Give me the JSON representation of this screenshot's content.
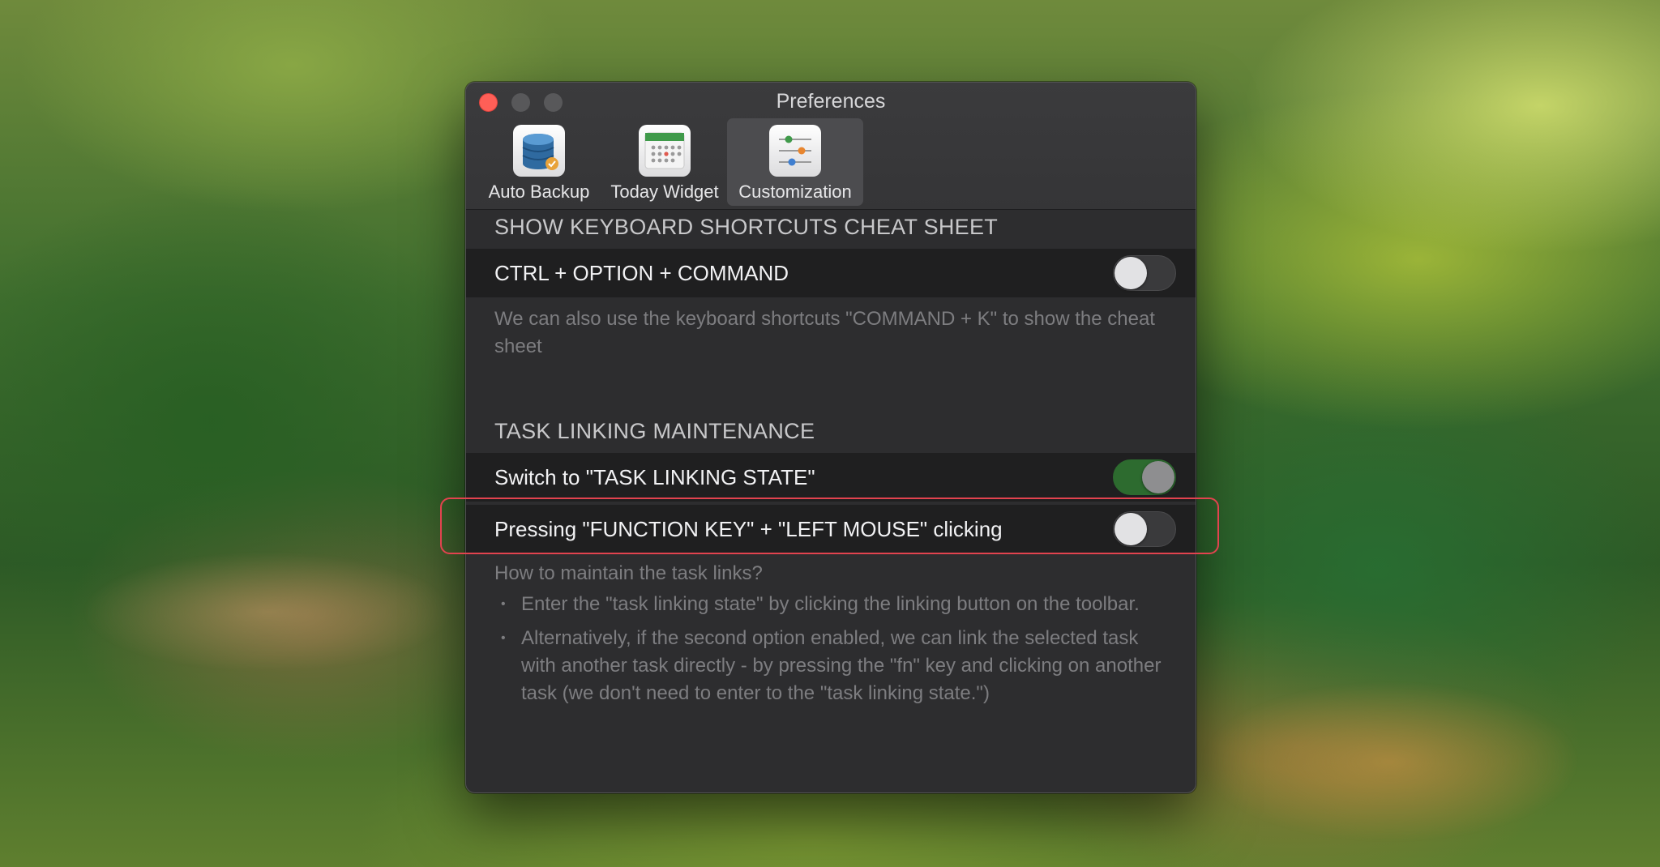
{
  "window": {
    "title": "Preferences"
  },
  "toolbar": {
    "tabs": [
      {
        "label": "Auto Backup",
        "icon": "database-icon",
        "active": false
      },
      {
        "label": "Today Widget",
        "icon": "calendar-icon",
        "active": false
      },
      {
        "label": "Customization",
        "icon": "sliders-icon",
        "active": true
      }
    ]
  },
  "cheat_sheet": {
    "title": "SHOW KEYBOARD SHORTCUTS CHEAT SHEET",
    "row_label": "CTRL + OPTION + COMMAND",
    "enabled": false,
    "description": "We can also use the keyboard shortcuts \"COMMAND + K\" to show the cheat sheet"
  },
  "task_linking": {
    "title": "TASK LINKING MAINTENANCE",
    "switch_label": "Switch to \"TASK LINKING STATE\"",
    "switch_enabled": true,
    "fn_label": "Pressing \"FUNCTION KEY\" + \"LEFT MOUSE\" clicking",
    "fn_enabled": false,
    "help_title": "How to maintain the task links?",
    "bullets": [
      "Enter the \"task linking state\" by clicking the linking button on the toolbar.",
      "Alternatively, if the second option enabled, we can link the selected task with another task directly - by pressing the \"fn\" key and clicking on another task (we don't need to enter to the \"task linking state.\")"
    ]
  },
  "colors": {
    "close": "#ff5f57",
    "highlight": "#e2434f",
    "toggle_on": "#2d6b2f"
  }
}
